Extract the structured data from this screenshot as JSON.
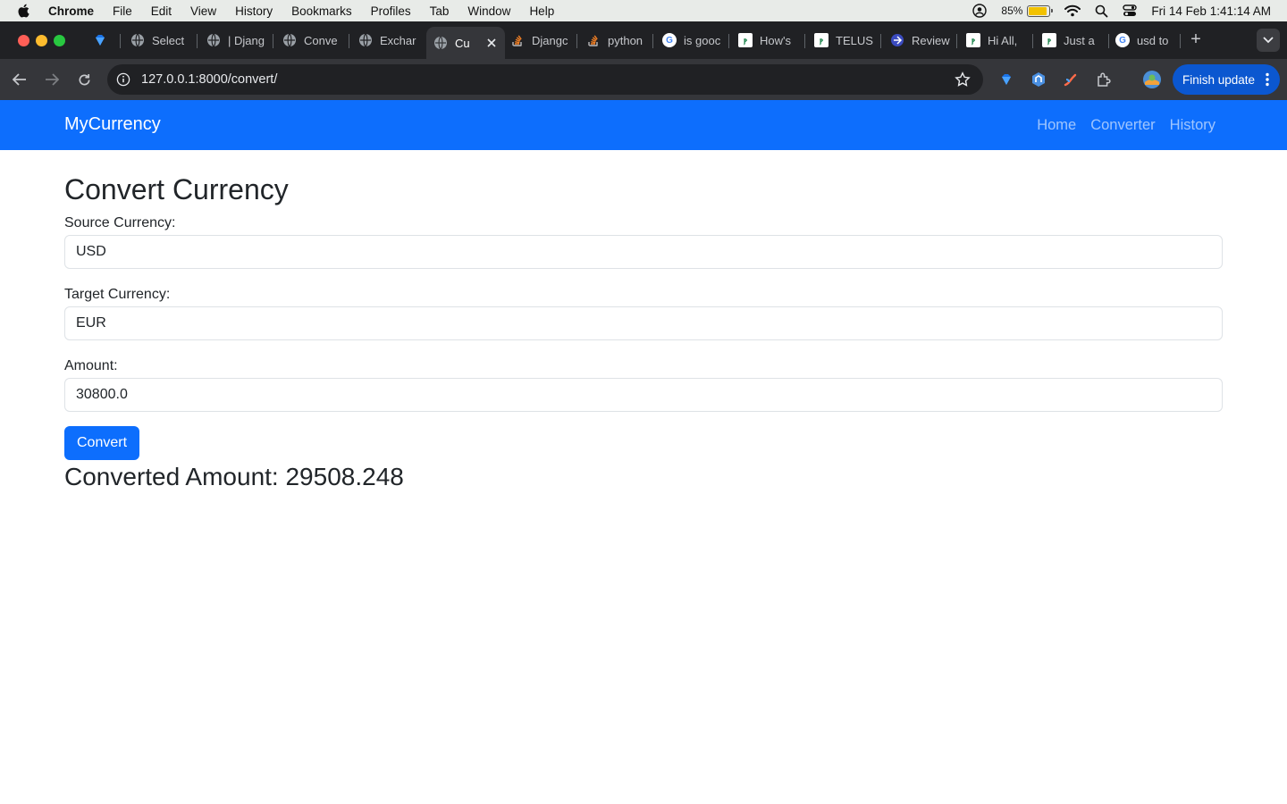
{
  "menubar": {
    "app": "Chrome",
    "items": [
      "File",
      "Edit",
      "View",
      "History",
      "Bookmarks",
      "Profiles",
      "Tab",
      "Window",
      "Help"
    ],
    "battery": "85%",
    "datetime": "Fri 14 Feb  1:41:14 AM"
  },
  "browser": {
    "tabs": [
      {
        "label": "Select"
      },
      {
        "label": "| Djang"
      },
      {
        "label": "Conve"
      },
      {
        "label": "Exchar"
      },
      {
        "label": "Cu"
      },
      {
        "label": "Djangc"
      },
      {
        "label": "python"
      },
      {
        "label": "is gooc"
      },
      {
        "label": "How's"
      },
      {
        "label": "TELUS"
      },
      {
        "label": "Review"
      },
      {
        "label": "Hi All,"
      },
      {
        "label": "Just a"
      },
      {
        "label": "usd to"
      }
    ],
    "url": "127.0.0.1:8000/convert/",
    "finish_update": "Finish update"
  },
  "site": {
    "brand": "MyCurrency",
    "nav": [
      "Home",
      "Converter",
      "History"
    ]
  },
  "form": {
    "title": "Convert Currency",
    "source_label": "Source Currency:",
    "source_value": "USD",
    "target_label": "Target Currency:",
    "target_value": "EUR",
    "amount_label": "Amount:",
    "amount_value": "30800.0",
    "submit_label": "Convert",
    "result": "Converted Amount: 29508.248"
  },
  "colors": {
    "primary": "#0d6efd",
    "chrome_dark": "#35363a",
    "tabstrip": "#202124"
  }
}
